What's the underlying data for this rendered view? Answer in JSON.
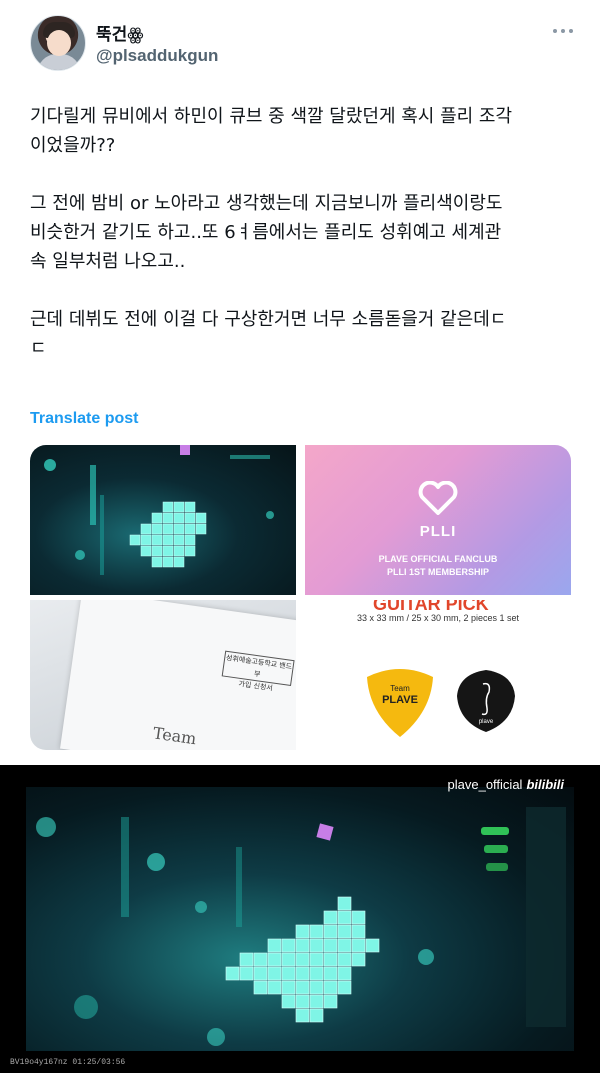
{
  "author": {
    "display_name": "뚝건",
    "display_suffix": "ꙮ",
    "handle": "@plsaddukgun"
  },
  "post": {
    "paragraphs": [
      "기다릴게 뮤비에서 하민이 큐브 중 색깔 달랐던게 혹시 플리 조각\n이었을까??",
      "그 전에 밤비 or 노아라고 생각했는데 지금보니까 플리색이랑도\n비슷한거 같기도 하고..또 6ㅕ름에서는 플리도 성휘예고 세계관\n속 일부처럼 나오고..",
      "근데 데뷔도 전에 이걸 다 구상한거면 너무 소름돋을거 같은데ㄷ\nㄷ"
    ],
    "translate_label": "Translate post"
  },
  "media": {
    "plli": {
      "name": "PLLI",
      "sub_line1": "PLAVE OFFICIAL FANCLUB",
      "sub_line2": "PLLI 1ST MEMBERSHIP"
    },
    "pick": {
      "title": "GUITAR PICK",
      "dims": "33 x 33 mm / 25 x 30 mm, 2 pieces 1 set",
      "yellow_label_top": "Team",
      "yellow_label_main": "PLAVE",
      "black_label": "plave"
    },
    "paper": {
      "box_line1": "성휘예술고등학교 밴드부",
      "box_line2": "가입 신청서",
      "scribble": "Team"
    }
  },
  "video": {
    "watermark_text": "plave_official",
    "watermark_brand": "bilibili",
    "caption": "BV19o4y167nz 01:25/03:56"
  },
  "colors": {
    "accent": "#1d9bf0",
    "text": "#0f1419",
    "muted": "#536471",
    "pick_yellow": "#f5b90f",
    "pick_title": "#e1462b"
  }
}
